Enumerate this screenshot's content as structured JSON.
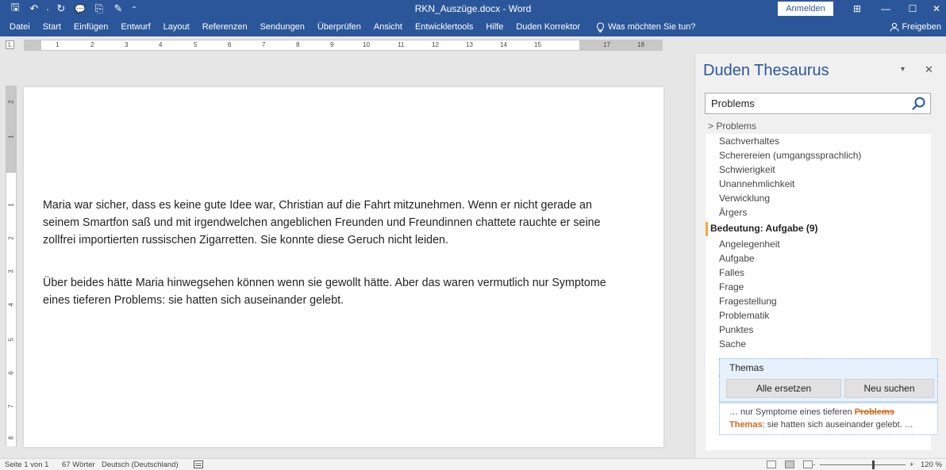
{
  "window": {
    "title": "RKN_Auszüge.docx  -  Word",
    "signin_label": "Anmelden",
    "minimize_glyph": "—",
    "maximize_glyph": "☐",
    "close_glyph": "✕",
    "display_options_glyph": "⊞"
  },
  "quick_access": [
    {
      "icon": "save-icon",
      "glyph": "🖫"
    },
    {
      "icon": "undo-icon",
      "glyph": "↶"
    },
    {
      "icon": "undo-dropdown-icon",
      "glyph": "·"
    },
    {
      "icon": "redo-icon",
      "glyph": "↻"
    },
    {
      "icon": "comment-icon",
      "glyph": "💬"
    },
    {
      "icon": "clipboard-icon",
      "glyph": "⎘"
    },
    {
      "icon": "format-painter-icon",
      "glyph": "✎"
    },
    {
      "icon": "customize-qat-icon",
      "glyph": "⁼"
    }
  ],
  "ribbon": {
    "tabs": [
      "Datei",
      "Start",
      "Einfügen",
      "Entwurf",
      "Layout",
      "Referenzen",
      "Sendungen",
      "Überprüfen",
      "Ansicht",
      "Entwicklertools",
      "Hilfe",
      "Duden Korrektor"
    ],
    "tell_me": "Was möchten Sie tun?",
    "share": "Freigeben"
  },
  "ruler": {
    "corner_glyph": "L",
    "h_numbers": [
      "1",
      "2",
      "3",
      "4",
      "5",
      "6",
      "7",
      "8",
      "9",
      "10",
      "11",
      "12",
      "13",
      "14",
      "15",
      "17",
      "18"
    ],
    "v_numbers": [
      "2",
      "1",
      "1",
      "2",
      "3",
      "4",
      "5",
      "6",
      "7",
      "8"
    ]
  },
  "document": {
    "paragraphs": [
      "Maria war sicher, dass es keine gute Idee war, Christian auf die Fahrt mitzunehmen. Wenn er nicht gerade an seinem Smartfon saß und mit irgendwelchen angeblichen Freunden und Freundinnen chattete rauchte er seine zollfrei importierten russischen Zigarretten. Sie konnte diese Geruch nicht leiden.",
      "Über beides hätte Maria hinwegsehen können wenn sie gewollt hätte. Aber das waren vermutlich nur Symptome eines tieferen Problems: sie hatten sich auseinander gelebt."
    ]
  },
  "thesaurus": {
    "title": "Duden Thesaurus",
    "dropdown_glyph": "▾",
    "close_glyph": "✕",
    "search_value": "Problems",
    "breadcrumb": "> Problems",
    "group1_items": [
      "Sachverhaltes",
      "Scherereien (umgangssprachlich)",
      "Schwierigkeit",
      "Unannehmlichkeit",
      "Verwicklung",
      "Ärgers"
    ],
    "section_heading": "Bedeutung: Aufgabe (9)",
    "group2_items": [
      "Angelegenheit",
      "Aufgabe",
      "Falles",
      "Frage",
      "Fragestellung",
      "Problematik",
      "Punktes",
      "Sache"
    ],
    "selected_word": "Themas",
    "replace_all_label": "Alle ersetzen",
    "new_search_label": "Neu suchen",
    "preview": {
      "prefix": "… nur Symptome eines tieferen ",
      "original": "Problems",
      "replacement": "Themas",
      "suffix": ": sie hatten sich auseinander gelebt. …"
    },
    "scroll_up_glyph": "^",
    "scroll_down_glyph": "v"
  },
  "statusbar": {
    "page": "Seite 1 von 1",
    "words": "67 Wörter",
    "language": "Deutsch (Deutschland)",
    "zoom": "120 %",
    "zoom_minus": "-",
    "zoom_plus": "+"
  },
  "colors": {
    "accent": "#2b579a",
    "highlight": "#f4a83a",
    "replacement": "#d26a1d"
  }
}
